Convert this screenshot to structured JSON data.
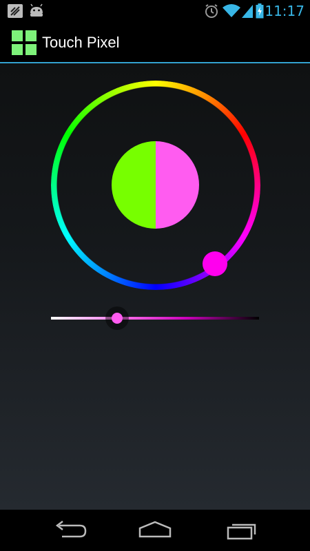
{
  "status_bar": {
    "time": "11:17",
    "left_icons": [
      "notification-icon",
      "android-debug-icon"
    ],
    "right_icons": [
      "alarm-icon",
      "wifi-icon",
      "signal-icon",
      "battery-charging-icon"
    ]
  },
  "action_bar": {
    "title": "Touch Pixel",
    "app_icon": "grid-app-icon",
    "app_icon_color": "#7ef27a",
    "divider_color": "#33a2cf"
  },
  "color_picker": {
    "ring": "hue-ring",
    "old_color": "#77ff00",
    "new_color": "#ff5cf0",
    "handle_color": "#ff00ee",
    "saturation_value_slider": {
      "thumb_color": "#ff5cf0",
      "level": 0.32
    }
  },
  "nav_bar": {
    "buttons": [
      "back-icon",
      "home-icon",
      "recent-apps-icon"
    ]
  }
}
